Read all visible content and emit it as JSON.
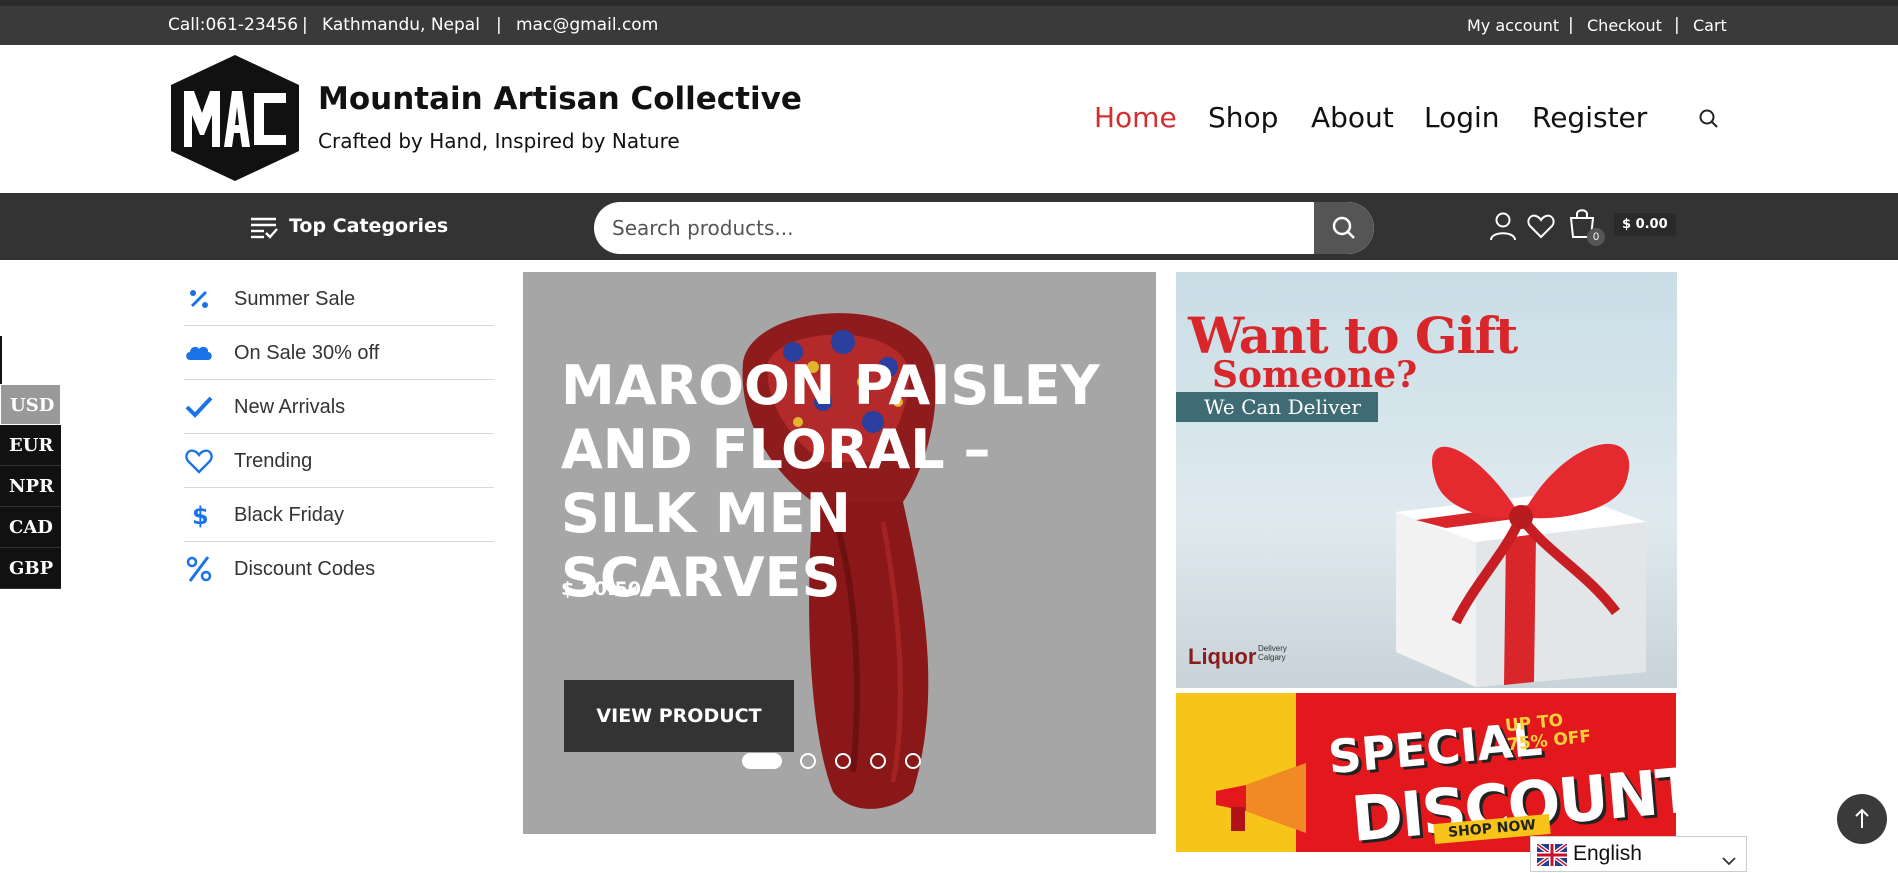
{
  "topbar": {
    "phone": "Call:061-23456",
    "location": "Kathmandu, Nepal",
    "email": "mac@gmail.com",
    "sep": "|",
    "links": {
      "account": "My account",
      "checkout": "Checkout",
      "cart": "Cart"
    }
  },
  "brand": {
    "logo_text": "MAC",
    "title": "Mountain Artisan Collective",
    "tagline": "Crafted by Hand, Inspired by Nature"
  },
  "nav": {
    "home": "Home",
    "shop": "Shop",
    "about": "About",
    "login": "Login",
    "register": "Register",
    "active": "Home",
    "active_color": "#d32f2f"
  },
  "toolbar": {
    "top_categories": "Top Categories",
    "search_placeholder": "Search products...",
    "cart_count": "0",
    "cart_total": "$ 0.00"
  },
  "categories": [
    {
      "label": "Summer Sale",
      "icon": "percent-icon"
    },
    {
      "label": "On Sale 30% off",
      "icon": "salesforce-cloud-icon"
    },
    {
      "label": "New Arrivals",
      "icon": "checkmark-icon"
    },
    {
      "label": "Trending",
      "icon": "heart-icon"
    },
    {
      "label": "Black Friday",
      "icon": "dollar-icon"
    },
    {
      "label": "Discount Codes",
      "icon": "percent-icon"
    }
  ],
  "currencies": [
    "USD",
    "EUR",
    "NPR",
    "CAD",
    "GBP"
  ],
  "currency_selected": "USD",
  "slider": {
    "title": "MAROON PAISLEY AND FLORAL – SILK MEN SCARVES",
    "price": "$ 10.50",
    "button": "VIEW PRODUCT",
    "slides_total": 5,
    "active_slide": 1
  },
  "banner_gift": {
    "line1": "Want to Gift",
    "line2": "Someone?",
    "line3": "We Can Deliver",
    "logo": "Liquor",
    "logo_sub": "Delivery Calgary"
  },
  "banner_discount": {
    "special": "SPECIAL",
    "upto": "UP TO",
    "percent": "75% OFF",
    "discount": "DISCOUNT",
    "shop_now": "SHOP NOW"
  },
  "language": {
    "selected": "English"
  },
  "colors": {
    "accent": "#d32f2f",
    "dark": "#333333",
    "icon_blue": "#1a73e8"
  }
}
